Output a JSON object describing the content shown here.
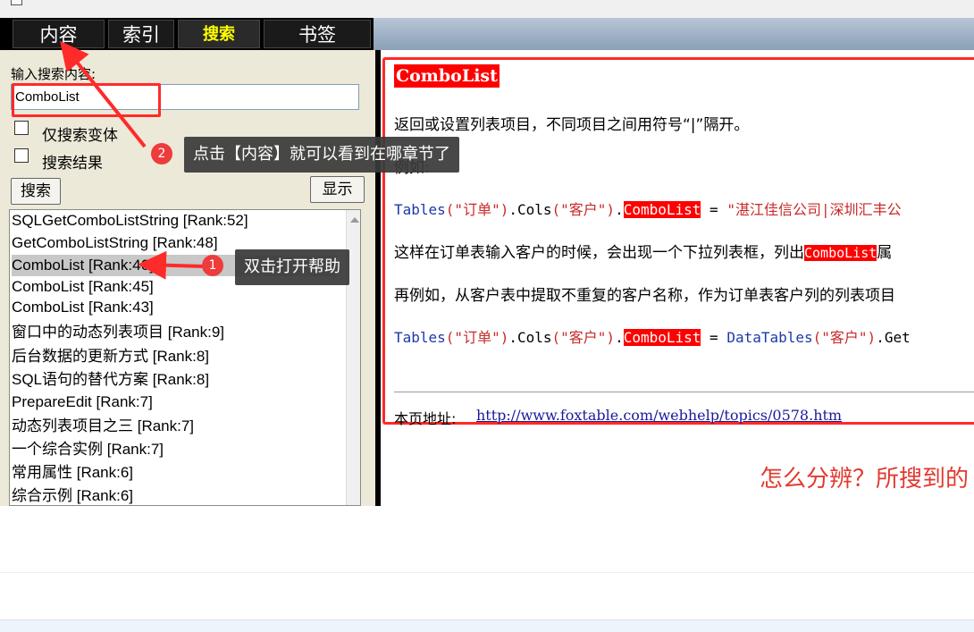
{
  "tabs": [
    {
      "label": "内容",
      "active": false
    },
    {
      "label": "索引",
      "active": false
    },
    {
      "label": "搜索",
      "active": true
    },
    {
      "label": "书签",
      "active": false
    }
  ],
  "search": {
    "label": "输入搜索内容:",
    "value": "ComboList",
    "option_variants": "仅搜索变体",
    "option_results": "搜索结果",
    "search_button": "搜索",
    "display_button": "显示"
  },
  "results": [
    "SQLGetComboListString [Rank:52]",
    "GetComboListString [Rank:48]",
    "ComboList [Rank:46]",
    "ComboList [Rank:45]",
    "ComboList [Rank:43]",
    "窗口中的动态列表项目 [Rank:9]",
    "后台数据的更新方式 [Rank:8]",
    "SQL语句的替代方案 [Rank:8]",
    "PrepareEdit [Rank:7]",
    "动态列表项目之三 [Rank:7]",
    "一个综合实例 [Rank:7]",
    "常用属性 [Rank:6]",
    "综合示例 [Rank:6]"
  ],
  "selected_result_index": 2,
  "page": {
    "title": "ComboList",
    "description": "返回或设置列表项目，不同项目之间用符号“|”隔开。",
    "example_label": "例如:",
    "code1": {
      "tables": "Tables",
      "arg1": "(\"订单\")",
      "cols": ".Cols",
      "arg2": "(\"客户\")",
      "dot": ".",
      "prop": "ComboList",
      "eq": " = ",
      "value": "\"湛江佳信公司|深圳汇丰公"
    },
    "para2_before": "这样在订单表输入客户的时候，会出现一个下拉列表框，列出",
    "para2_hl": "ComboList",
    "para2_after": "属",
    "para3": "再例如，从客户表中提取不重复的客户名称，作为订单表客户列的列表项目",
    "code2": {
      "tables": "Tables",
      "arg1": "(\"订单\")",
      "cols": ".Cols",
      "arg2": "(\"客户\")",
      "dot": ".",
      "prop": "ComboList",
      "eq": " = ",
      "dt": "DataTables",
      "arg3": "(\"客户\")",
      "rest": ".Get"
    },
    "url_label": "本页地址:",
    "url": "http://www.foxtable.com/webhelp/topics/0578.htm"
  },
  "annotations": {
    "badge1": "1",
    "tip1": "双击打开帮助",
    "badge2": "2",
    "tip2": "点击【内容】就可以看到在哪章节了",
    "note": "怎么分辨？所搜到的"
  },
  "colors": {
    "annotation_red": "#ff2a2a",
    "highlight_red": "#ff0000",
    "active_tab_text": "#ffff00",
    "code_blue": "#1c39a8",
    "code_string_red": "#c82a2a",
    "note_red": "#e23a2f"
  }
}
